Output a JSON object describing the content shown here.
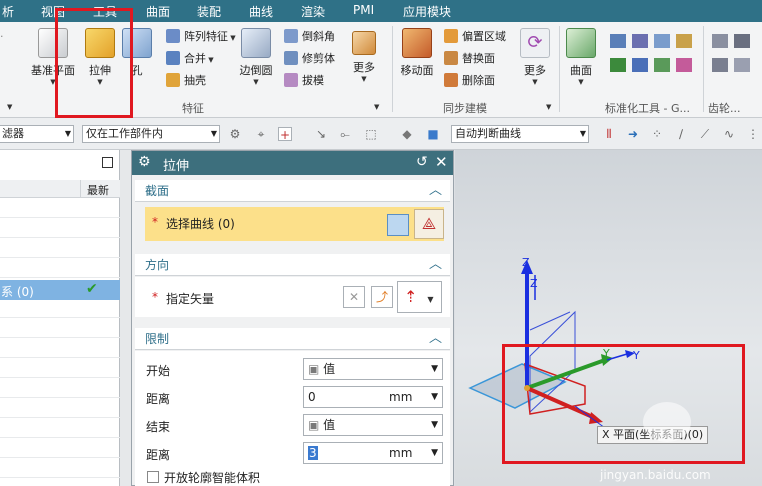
{
  "menubar": {
    "items": [
      "析",
      "视图",
      "工具",
      "曲面",
      "装配",
      "曲线",
      "渲染",
      "PMI",
      "应用模块"
    ]
  },
  "ribbon": {
    "datum_plane": "基准平面",
    "extrude": "拉伸",
    "hole": "孔",
    "pattern_feature": "阵列特征",
    "unite": "合并",
    "shell": "抽壳",
    "edge_blend": "边倒圆",
    "chamfer": "倒斜角",
    "trim_body": "修剪体",
    "draft": "拔模",
    "more_1": "更多",
    "move_face": "移动面",
    "offset_region": "偏置区域",
    "replace_face": "替换面",
    "delete_face": "删除面",
    "more_2": "更多",
    "surface": "曲面",
    "group_feature": "特征",
    "group_sync": "同步建模",
    "group_standard": "标准化工具 - G...",
    "group_gear": "齿轮..."
  },
  "toolbar": {
    "filter": "滤器",
    "scope": "仅在工作部件内",
    "curve_rule": "自动判断曲线"
  },
  "left_panel": {
    "col_latest": "最新",
    "row_text": "系 (0)"
  },
  "dialog": {
    "title": "拉伸",
    "section_profile": "截面",
    "select_curve": "选择曲线 (0)",
    "section_direction": "方向",
    "specify_vector": "指定矢量",
    "section_limits": "限制",
    "start_label": "开始",
    "start_value": "值",
    "distance_label_1": "距离",
    "distance_value_1": "0",
    "unit_1": "mm",
    "end_label": "结束",
    "end_value": "值",
    "distance_label_2": "距离",
    "distance_value_2": "3",
    "unit_2": "mm",
    "open_profile": "开放轮廓智能体积"
  },
  "viewport": {
    "axis_z": "Z",
    "axis_z2": "Z",
    "axis_y": "Y",
    "axis_y2": "Y",
    "axis_x": "X",
    "status": "X 平面(坐标系面)(0)",
    "watermark": "jingyan.baidu.com"
  },
  "colors": {
    "menubar": "#2f7187",
    "highlight": "#fce08a",
    "annotation_red": "#e01820",
    "axis_blue": "#1a2fe0",
    "axis_green": "#2a9a2a",
    "axis_red": "#d02020"
  }
}
